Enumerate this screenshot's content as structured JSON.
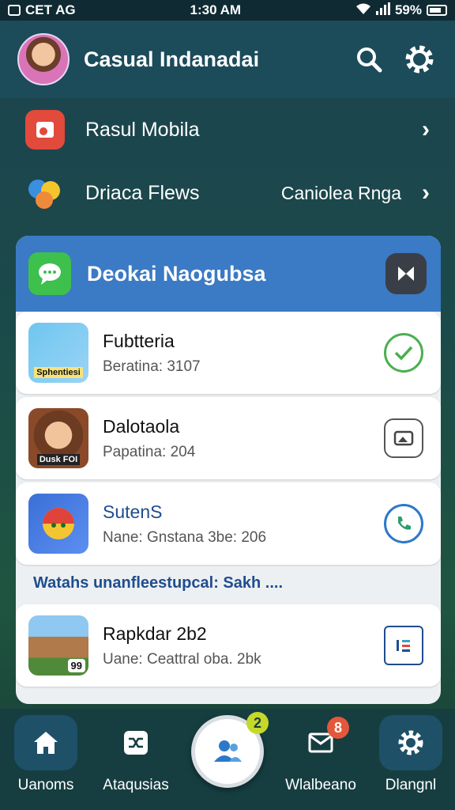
{
  "status_bar": {
    "carrier": "CET AG",
    "time": "1:30 AM",
    "battery": "59%"
  },
  "header": {
    "title": "Casual Indanadai"
  },
  "rows": [
    {
      "label": "Rasul Mobila",
      "value": ""
    },
    {
      "label": "Driaca Flews",
      "value": "Caniolea Rnga"
    }
  ],
  "card": {
    "title": "Deokai Naogubsa",
    "items": [
      {
        "title": "Fubtteria",
        "subtitle": "Beratina: 3107",
        "thumb_text": "Sphentiesi"
      },
      {
        "title": "Dalotaola",
        "subtitle": "Papatina: 204",
        "thumb_text": "Dusk FOI"
      },
      {
        "title": "SutenS",
        "subtitle": "Nane: Gnstana 3be: 206",
        "thumb_text": ""
      }
    ],
    "section_label": "Watahs unanfleestupcal: Sakh ....",
    "extra_item": {
      "title": "Rapkdar 2b2",
      "subtitle": "Uane: Ceattral oba. 2bk",
      "thumb_text": "99"
    }
  },
  "bottom_nav": {
    "items": [
      {
        "label": "Uanoms"
      },
      {
        "label": "Ataqusias"
      },
      {
        "label": "Wlalbeano"
      },
      {
        "label": "Dlangnl"
      }
    ],
    "fab_badge": "2",
    "inbox_badge": "8"
  },
  "colors": {
    "accent": "#3b7ac4",
    "success": "#4caf50",
    "header": "#1c4b5a"
  }
}
